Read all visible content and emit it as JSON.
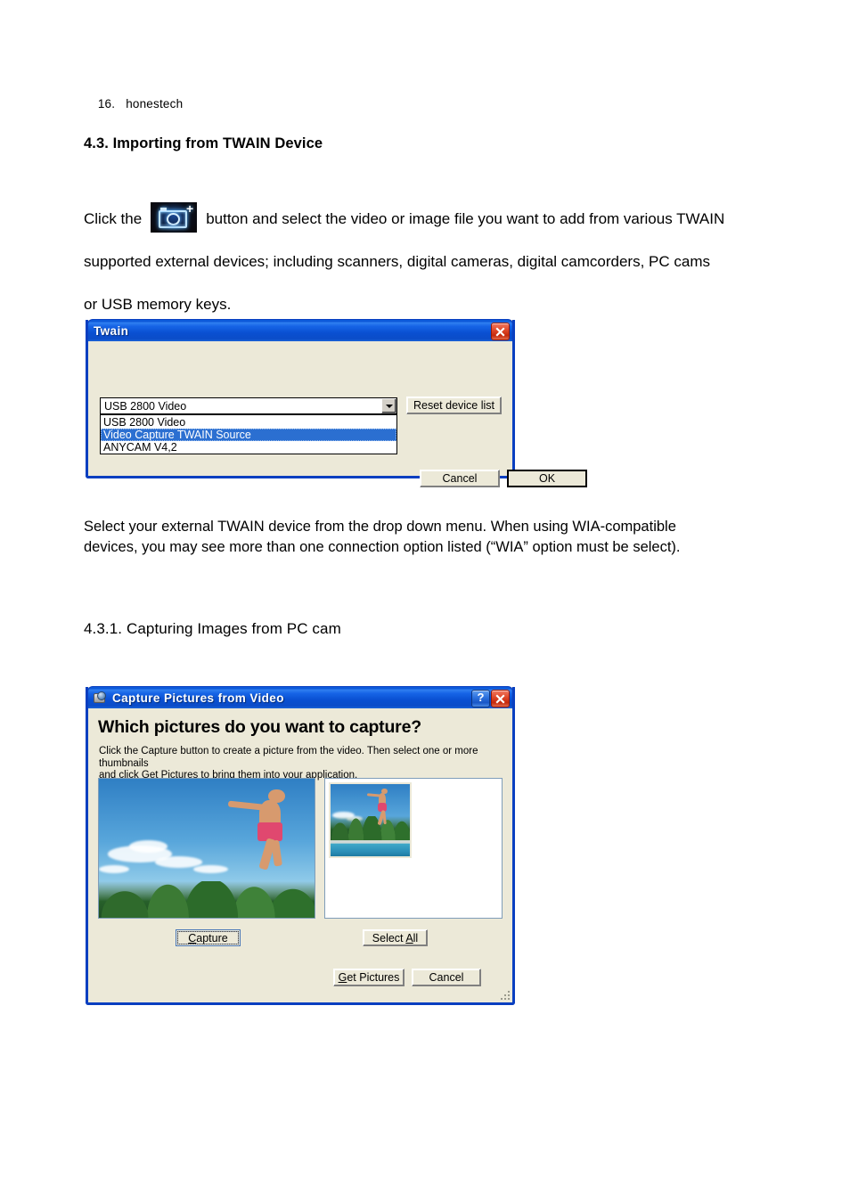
{
  "document": {
    "page_number": "16.",
    "brand": "honestech",
    "section_title": "4.3. Importing from TWAIN Device",
    "paragraph_1": {
      "before_icon": "Click the",
      "icon_name": "add-picture-camera-icon",
      "after_icon": "button and select the video or image file you want to add from various TWAIN",
      "line_2": "supported external devices; including scanners, digital cameras, digital camcorders, PC cams",
      "line_3": "or USB memory keys."
    },
    "paragraph_2": {
      "line_1": "Select your external TWAIN device from the drop down menu.   When using WIA-compatible",
      "line_2": "devices, you may see more than one connection option listed (“WIA” option must be select)."
    },
    "subsection_title": "4.3.1. Capturing Images from PC cam"
  },
  "twain_dialog": {
    "title": "Twain",
    "close_label": "×",
    "device_select": {
      "value": "USB 2800 Video",
      "options": [
        {
          "label": "USB 2800 Video",
          "selected": false
        },
        {
          "label": "Video Capture  TWAIN Source",
          "selected": true
        },
        {
          "label": "ANYCAM V4,2",
          "selected": false
        }
      ]
    },
    "reset_button": "Reset device list",
    "cancel_button": "Cancel",
    "ok_button": "OK"
  },
  "capture_dialog": {
    "title": "Capture Pictures from Video",
    "help_label": "?",
    "close_label": "×",
    "heading": "Which pictures do you want to capture?",
    "instructions_line_1": "Click the Capture button to create a picture from the video.  Then select one or more thumbnails",
    "instructions_line_2": "and click Get Pictures to bring them into your application.",
    "preview_alt": "Boy in pink swim shorts jumping through blue sky above green trees",
    "thumbnail_alt": "Captured thumbnail of boy jumping over swimming pool",
    "buttons": {
      "capture": {
        "prefix": "",
        "accel": "C",
        "suffix": "apture"
      },
      "select_all": {
        "prefix": "Select ",
        "accel": "A",
        "suffix": "ll"
      },
      "get_pictures": {
        "prefix": "",
        "accel": "G",
        "suffix": "et Pictures"
      },
      "cancel": {
        "prefix": "Cancel",
        "accel": "",
        "suffix": ""
      }
    }
  },
  "colors": {
    "titlebar_blue": "#0a54d6",
    "dialog_face": "#ece9d8",
    "selection_blue": "#2b6fd1",
    "close_red": "#c5290c",
    "page_background": "#ffffff"
  }
}
